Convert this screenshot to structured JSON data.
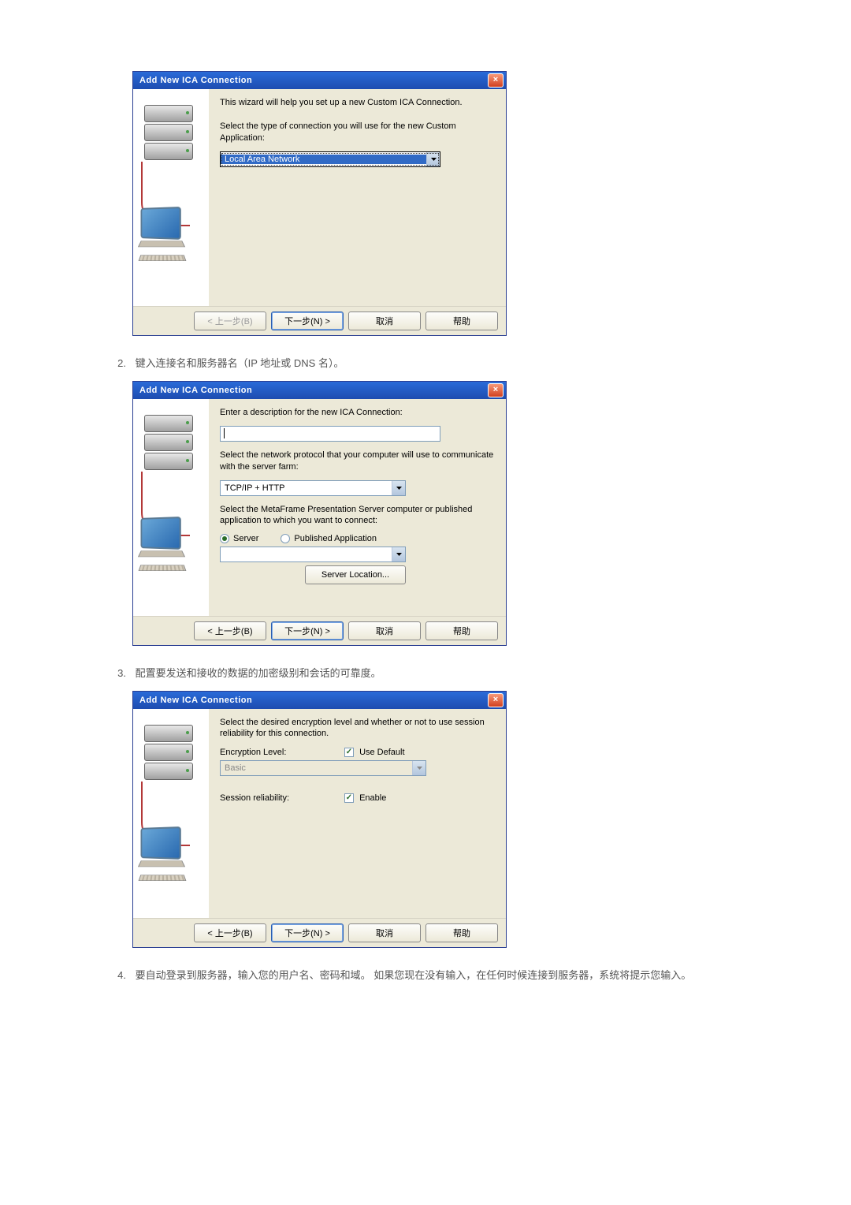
{
  "steps": {
    "s2": {
      "num": "2.",
      "text": "键入连接名和服务器名（IP 地址或 DNS 名）。"
    },
    "s3": {
      "num": "3.",
      "text": "配置要发送和接收的数据的加密级别和会话的可靠度。"
    },
    "s4": {
      "num": "4.",
      "text": "要自动登录到服务器，输入您的用户名、密码和域。 如果您现在没有输入，在任何时候连接到服务器，系统将提示您输入。"
    }
  },
  "dlg1": {
    "title": "Add New ICA Connection",
    "intro": "This wizard will help you set up a new Custom ICA Connection.",
    "instruct": "Select the type of connection you will use for the new Custom Application:",
    "conn_type": "Local Area Network",
    "back": "< 上一步(B)",
    "next": "下一步(N) >",
    "cancel": "取消",
    "help": "帮助"
  },
  "dlg2": {
    "title": "Add New ICA Connection",
    "desc_label": "Enter a description for the new ICA Connection:",
    "proto_label": "Select the network protocol that your computer will use to communicate with the server farm:",
    "proto_value": "TCP/IP + HTTP",
    "select_label": "Select the MetaFrame Presentation Server computer or published application to which you want to connect:",
    "radio_server": "Server",
    "radio_pubapp": "Published Application",
    "server_loc": "Server Location...",
    "back": "< 上一步(B)",
    "next": "下一步(N) >",
    "cancel": "取消",
    "help": "帮助"
  },
  "dlg3": {
    "title": "Add New ICA Connection",
    "instruct": "Select the desired encryption level and whether or not to use session reliability for this connection.",
    "enc_label": "Encryption Level:",
    "use_default": "Use Default",
    "enc_value": "Basic",
    "sess_label": "Session reliability:",
    "sess_enable": "Enable",
    "back": "< 上一步(B)",
    "next": "下一步(N) >",
    "cancel": "取消",
    "help": "帮助"
  }
}
